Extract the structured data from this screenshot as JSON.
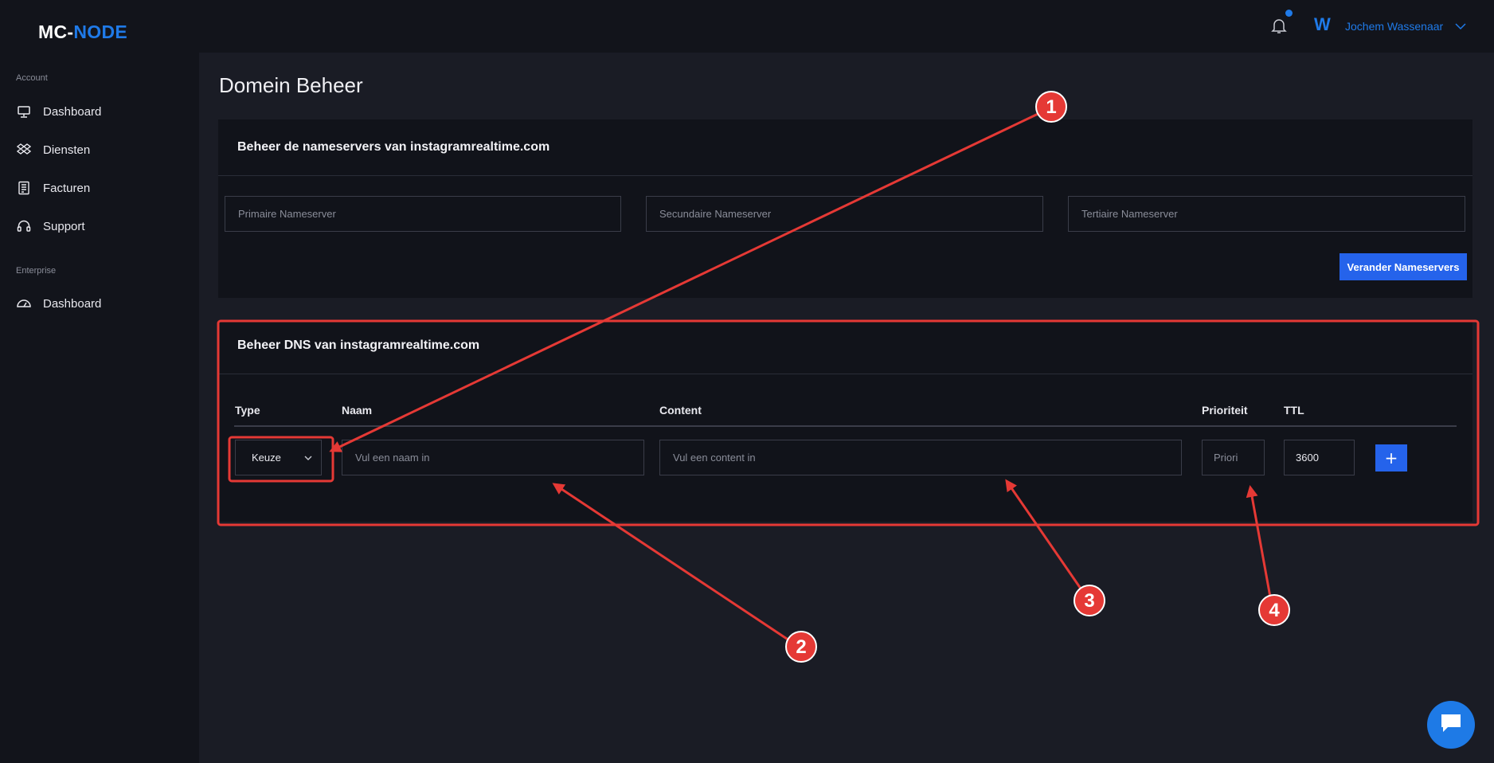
{
  "brand": {
    "part1": "MC-",
    "part2": "NODE"
  },
  "sidebar": {
    "sections": [
      {
        "label": "Account",
        "items": [
          {
            "label": "Dashboard",
            "icon": "monitor-icon"
          },
          {
            "label": "Diensten",
            "icon": "dropbox-icon"
          },
          {
            "label": "Facturen",
            "icon": "invoice-icon"
          },
          {
            "label": "Support",
            "icon": "headset-icon"
          }
        ]
      },
      {
        "label": "Enterprise",
        "items": [
          {
            "label": "Dashboard",
            "icon": "gauge-icon"
          }
        ]
      }
    ]
  },
  "topbar": {
    "notification_icon": "bell-icon",
    "has_unread": true,
    "avatar_letter": "W",
    "username": "Jochem Wassenaar"
  },
  "page": {
    "title": "Domein Beheer"
  },
  "nameservers": {
    "title": "Beheer de nameservers van instagramrealtime.com",
    "primary_placeholder": "Primaire Nameserver",
    "secondary_placeholder": "Secundaire Nameserver",
    "tertiary_placeholder": "Tertiaire Nameserver",
    "submit_label": "Verander Nameservers"
  },
  "dns": {
    "title": "Beheer DNS van instagramrealtime.com",
    "columns": [
      "Type",
      "Naam",
      "Content",
      "Prioriteit",
      "TTL"
    ],
    "type_selected": "Keuze",
    "name_placeholder": "Vul een naam in",
    "content_placeholder": "Vul een content in",
    "priority_placeholder": "Priori",
    "ttl_value": "3600",
    "add_label": "+"
  },
  "annotations": {
    "color": "#e53935",
    "badges": [
      "1",
      "2",
      "3",
      "4"
    ]
  },
  "colors": {
    "accent": "#2563eb",
    "brand_blue": "#1f7ae8",
    "background": "#1a1c25",
    "sidebar": "#12141b"
  }
}
